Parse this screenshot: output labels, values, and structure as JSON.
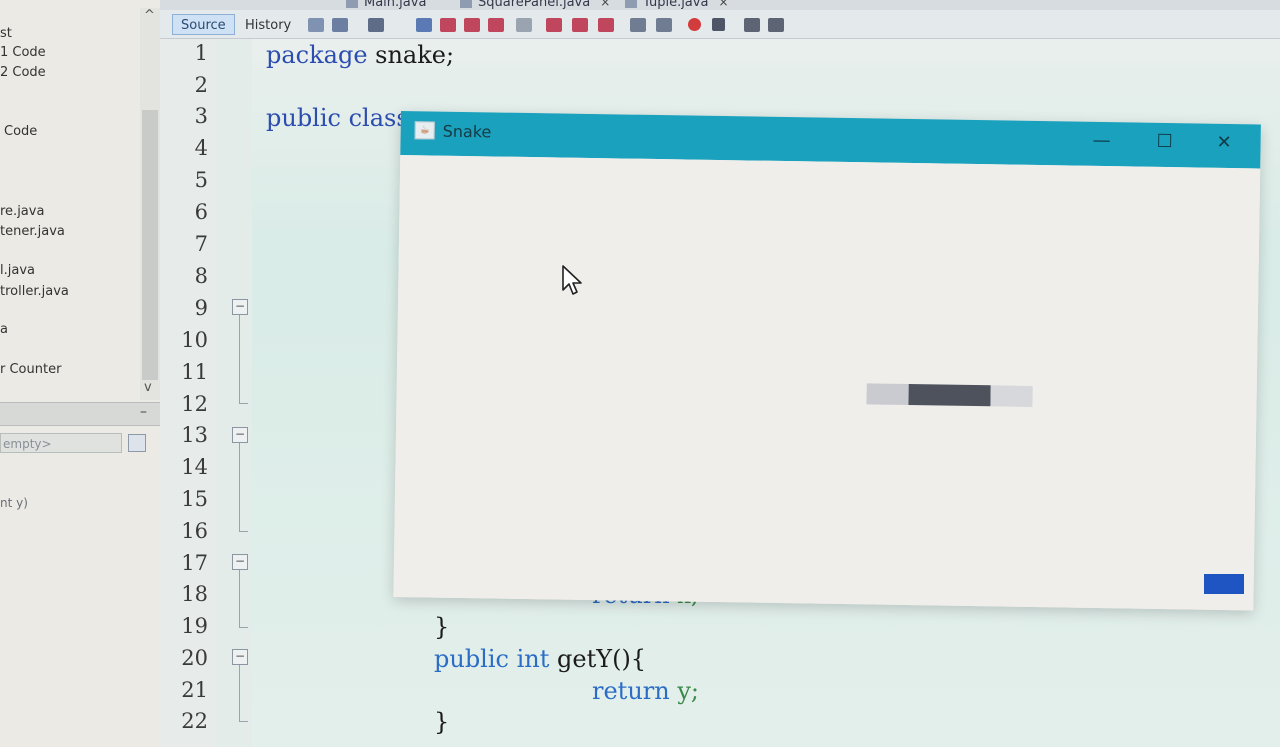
{
  "navigator": {
    "items": [
      "st",
      "1 Code",
      "2 Code",
      "Code",
      "re.java",
      "tener.java",
      "l.java",
      "troller.java",
      "a",
      "r Counter"
    ],
    "filter_placeholder": "empty>",
    "signature": "nt y)",
    "scroll_up": "^",
    "scroll_down": "v",
    "minimize": "–"
  },
  "tabs": [
    {
      "label": "Main.java",
      "icon": "java-file-icon"
    },
    {
      "label": "SquarePanel.java",
      "icon": "java-file-icon",
      "close": "×"
    },
    {
      "label": "Tuple.java",
      "icon": "java-file-icon",
      "close": "×"
    }
  ],
  "toolbar": {
    "source_label": "Source",
    "history_label": "History",
    "icons": [
      "back-icon",
      "forward-icon",
      "search-icon",
      "find-prev-icon",
      "find-next-icon",
      "toggle-highlight-icon",
      "bookmark-prev-icon",
      "bookmark-next-icon",
      "shift-left-icon",
      "shift-right-icon",
      "record-macro-icon",
      "stop-macro-icon",
      "comment-icon",
      "uncomment-icon"
    ]
  },
  "editor": {
    "line_numbers": [
      "1",
      "2",
      "3",
      "4",
      "5",
      "6",
      "7",
      "8",
      "9",
      "10",
      "11",
      "12",
      "13",
      "14",
      "15",
      "16",
      "17",
      "18",
      "19",
      "20",
      "21",
      "22"
    ],
    "lines": {
      "l1_kw": "package",
      "l1_rest": " snake;",
      "l3_kw": "public class",
      "l18_kw": "return",
      "l18_var": " x;",
      "l19": "}",
      "l20_kw": "public int",
      "l20_rest": " getY(){",
      "l21_kw": "return",
      "l21_var": " y;",
      "l22": "}"
    }
  },
  "snake_window": {
    "title": "Snake",
    "minimize": "—",
    "maximize": "☐",
    "close": "✕",
    "colors": {
      "titlebar": "#1aa1bd",
      "snake_body": "#4e525c",
      "snake_trail": "#c9cbd1",
      "food": "#1f55c2"
    }
  }
}
